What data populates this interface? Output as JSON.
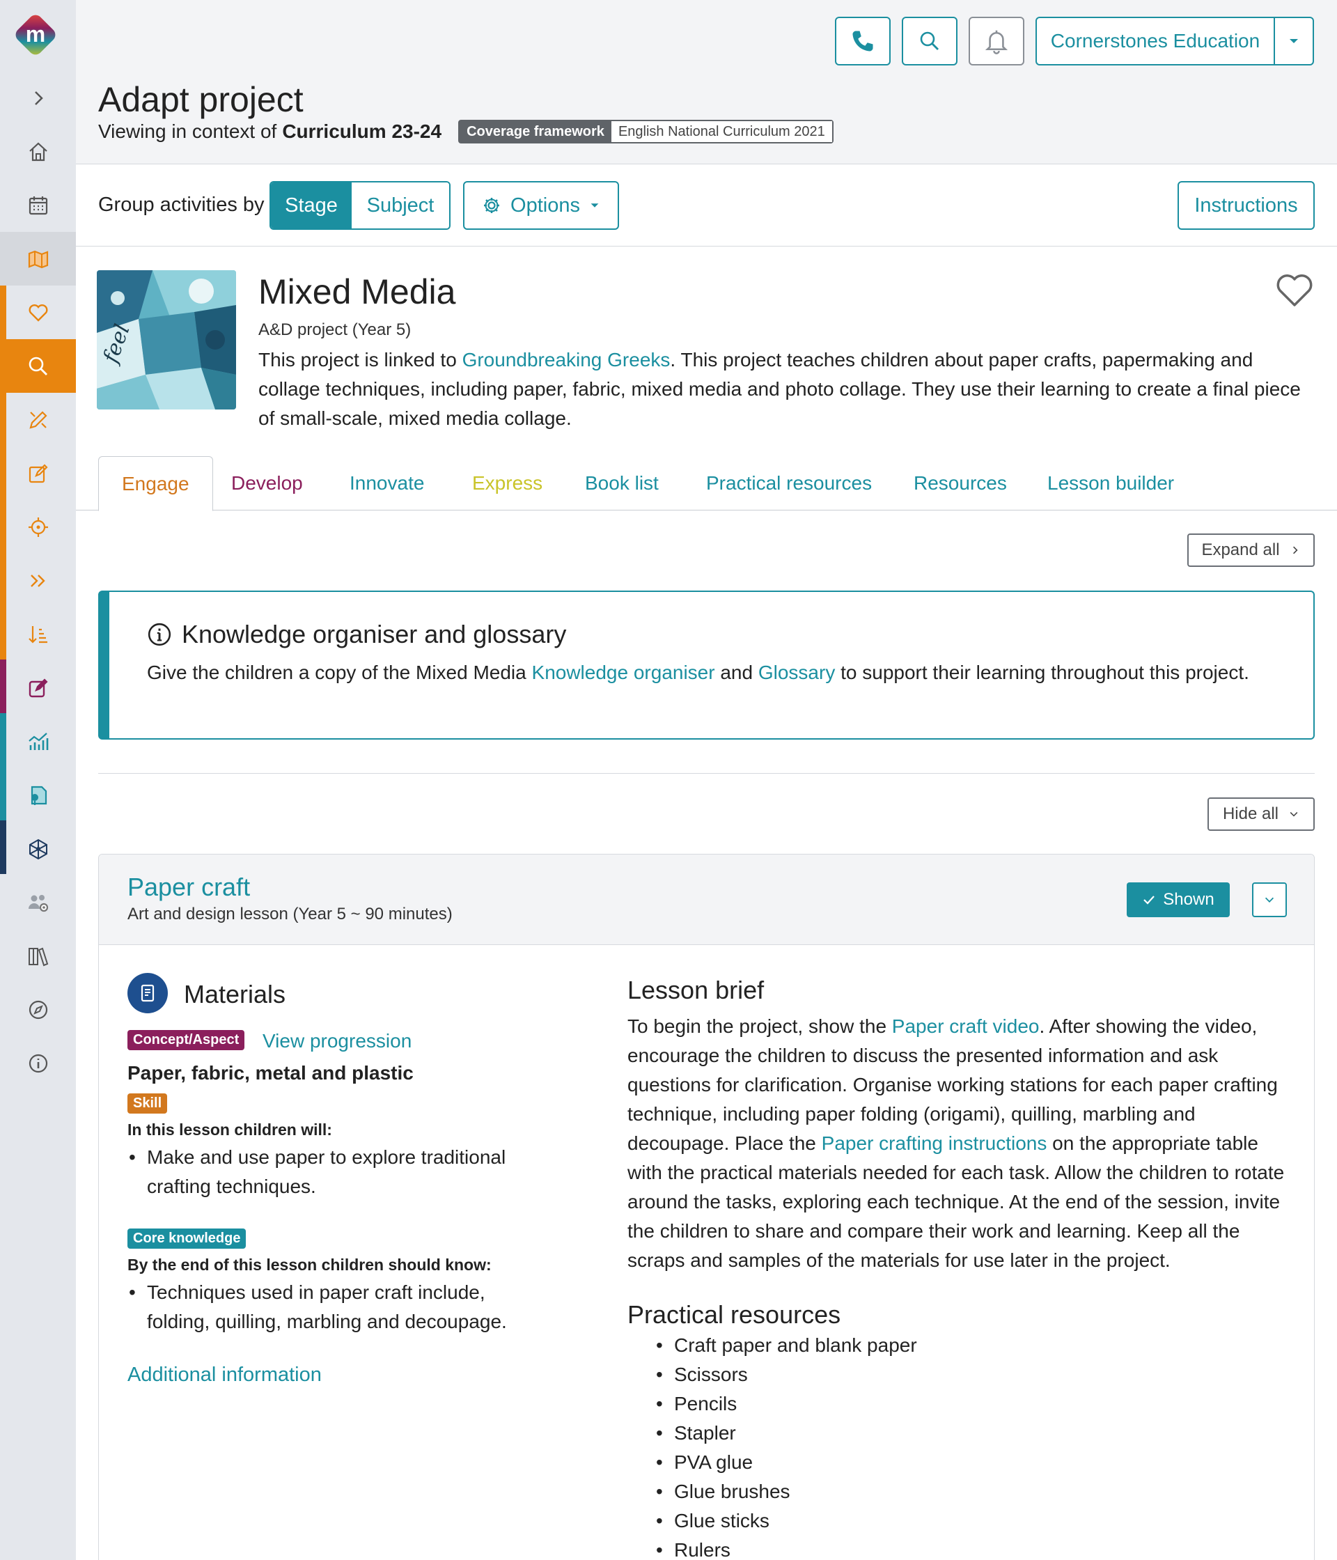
{
  "header": {
    "org_name": "Cornerstones Education",
    "page_title": "Adapt project",
    "context_prefix": "Viewing in context of",
    "context_value": "Curriculum 23-24",
    "coverage_key": "Coverage framework",
    "coverage_value": "English National Curriculum 2021"
  },
  "toolbar": {
    "group_label": "Group activities by",
    "group_options": [
      "Stage",
      "Subject"
    ],
    "selected_group": "Stage",
    "options_label": "Options",
    "instructions_label": "Instructions"
  },
  "project": {
    "title": "Mixed Media",
    "subtitle": "A&D project (Year 5)",
    "desc_prefix": "This project is linked to",
    "linked_project": "Groundbreaking Greeks",
    "desc_rest": ". This project teaches children about paper crafts, papermaking and collage techniques, including paper, fabric, mixed media and photo collage. They use their learning to create a final piece of small-scale, mixed media collage."
  },
  "tabs": [
    {
      "label": "Engage",
      "color": "#d2781e"
    },
    {
      "label": "Develop",
      "color": "#8b1f5c"
    },
    {
      "label": "Innovate",
      "color": "#1b8fa0"
    },
    {
      "label": "Express",
      "color": "#c9c42a"
    },
    {
      "label": "Book list",
      "color": "#1b8fa0"
    },
    {
      "label": "Practical resources",
      "color": "#1b8fa0"
    },
    {
      "label": "Resources",
      "color": "#1b8fa0"
    },
    {
      "label": "Lesson builder",
      "color": "#1b8fa0"
    }
  ],
  "expand_all_label": "Expand all",
  "hide_all_label": "Hide all",
  "knowledge": {
    "title": "Knowledge organiser and glossary",
    "text_before": "Give the children a copy of the Mixed Media",
    "link1": "Knowledge organiser",
    "text_mid": "and",
    "link2": "Glossary",
    "text_after": "to support their learning throughout this project."
  },
  "lesson": {
    "title": "Paper craft",
    "subtitle": "Art and design lesson (Year 5 ~ 90 minutes)",
    "shown_label": "Shown",
    "section_title": "Materials",
    "concept_tag": "Concept/Aspect",
    "view_progression": "View progression",
    "concept": "Paper, fabric, metal and plastic",
    "skill_tag": "Skill",
    "skill_intro": "In this lesson children will:",
    "skill_item": "Make and use paper to explore traditional crafting techniques.",
    "core_tag": "Core knowledge",
    "core_intro": "By the end of this lesson children should know:",
    "core_item": "Techniques used in paper craft include, folding, quilling, marbling and decoupage.",
    "additional_info": "Additional information",
    "brief_title": "Lesson brief",
    "brief_p1": "To begin the project, show the",
    "brief_link1": "Paper craft video",
    "brief_p2": ". After showing the video, encourage the children to discuss the presented information and ask questions for clarification. Organise working stations for each paper crafting technique, including paper folding (origami), quilling, marbling and decoupage. Place the",
    "brief_link2": "Paper crafting instructions",
    "brief_p3": "on the appropriate table with the practical materials needed for each task. Allow the children to rotate around the tasks, exploring each technique. At the end of the session, invite the children to share and compare their work and learning. Keep all the scraps and samples of the materials for use later in the project.",
    "practical_title": "Practical resources",
    "practical_items": [
      "Craft paper and blank paper",
      "Scissors",
      "Pencils",
      "Stapler",
      "PVA glue",
      "Glue brushes",
      "Glue sticks",
      "Rulers"
    ]
  },
  "colors": {
    "accent": "#1b8fa0",
    "sidebar_orange": "#e8850f",
    "concept_tag": "#8b1f5c",
    "skill_tag": "#d2781e",
    "core_tag": "#1b8fa0"
  },
  "sidebar_icons": [
    "logo-icon",
    "expand-icon",
    "home-icon",
    "calendar-icon",
    "map-icon",
    "heart-icon",
    "search-icon",
    "pencil-ruler-icon",
    "edit-icon",
    "target-icon",
    "double-chevron-icon",
    "sort-icon",
    "edit-square-icon",
    "chart-icon",
    "document-pin-icon",
    "network-icon",
    "users-gear-icon",
    "books-icon",
    "compass-icon",
    "info-icon"
  ]
}
